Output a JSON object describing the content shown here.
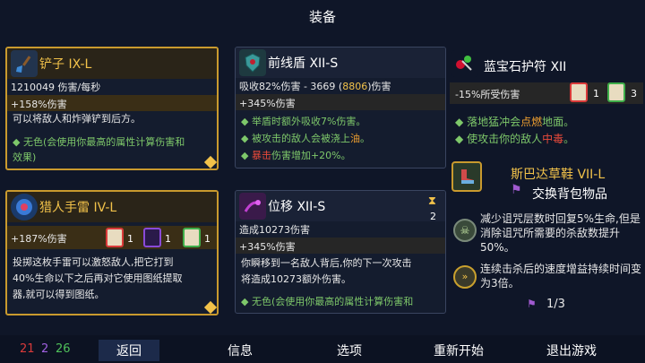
{
  "title": "装备",
  "cards": {
    "shovel": {
      "icon": "shovel-icon",
      "name": "铲子 IX-L",
      "stat1": "1210049 伤害/每秒",
      "stat2": "+158%伤害",
      "desc": "可以将敌人和炸弹铲到后方。",
      "bullet_text": "无色(会使用你最高的属性计算伤害和",
      "bullet_text2": "效果)"
    },
    "shield": {
      "icon": "shield-icon",
      "name": "前线盾 XII-S",
      "stat1_a": "吸收82%伤害 - 3669 (",
      "stat1_b": "8806",
      "stat1_c": ")伤害",
      "stat2": "+345%伤害",
      "b1": "举盾时额外吸收7%伤害。",
      "b2_a": "被攻击的敌人会被浇上",
      "b2_b": "油",
      "b2_c": "。",
      "b3_a": "暴击",
      "b3_b": "伤害增加+20%。"
    },
    "amulet": {
      "icon": "amulet-icon",
      "name": "蓝宝石护符 XII",
      "stat1": "-15%所受伤害",
      "count1": "1",
      "count2": "3",
      "b1_a": "落地猛冲会",
      "b1_b": "点燃",
      "b1_c": "地面。",
      "b2_a": "使攻击你的敌人",
      "b2_b": "中毒",
      "b2_c": "。"
    },
    "grenade": {
      "icon": "grenade-icon",
      "name": "猎人手雷 IV-L",
      "stat1": "+187%伤害",
      "count1": "1",
      "count2": "1",
      "count3": "1",
      "desc1": "投掷这枚手雷可以激怒敌人,把它打到",
      "desc2": "40%生命以下之后再对它使用图纸提取",
      "desc3": "器,就可以得到图纸。"
    },
    "displace": {
      "icon": "displace-icon",
      "name": "位移 XII-S",
      "stat1": "造成10273伤害",
      "stat2": "+345%伤害",
      "charges": "2",
      "desc1": "你瞬移到一名敌人背后,你的下一次攻击",
      "desc2": "将造成10273额外伤害。",
      "bullet_text": "无色(会使用你最高的属性计算伤害和"
    }
  },
  "outfit": {
    "icon": "boots-icon",
    "name": "斯巴达草鞋 VII-L",
    "swap_label": "交换背包物品",
    "effect1": "减少诅咒层数时回复5%生命,但是消除诅咒所需要的杀敌数提升50%。",
    "effect2": "连续击杀后的速度增益持续时间变为3倍。",
    "page": "1/3"
  },
  "footer": {
    "count_red": "21",
    "count_purple": "2",
    "count_green": "26",
    "back": "返回",
    "info": "信息",
    "options": "选项",
    "restart": "重新开始",
    "quit": "退出游戏"
  },
  "colors": {
    "brutality": "#d93a3a",
    "tactics": "#8a4ad9",
    "survival": "#3fae4a",
    "gold_frame": "#c99a2e"
  }
}
